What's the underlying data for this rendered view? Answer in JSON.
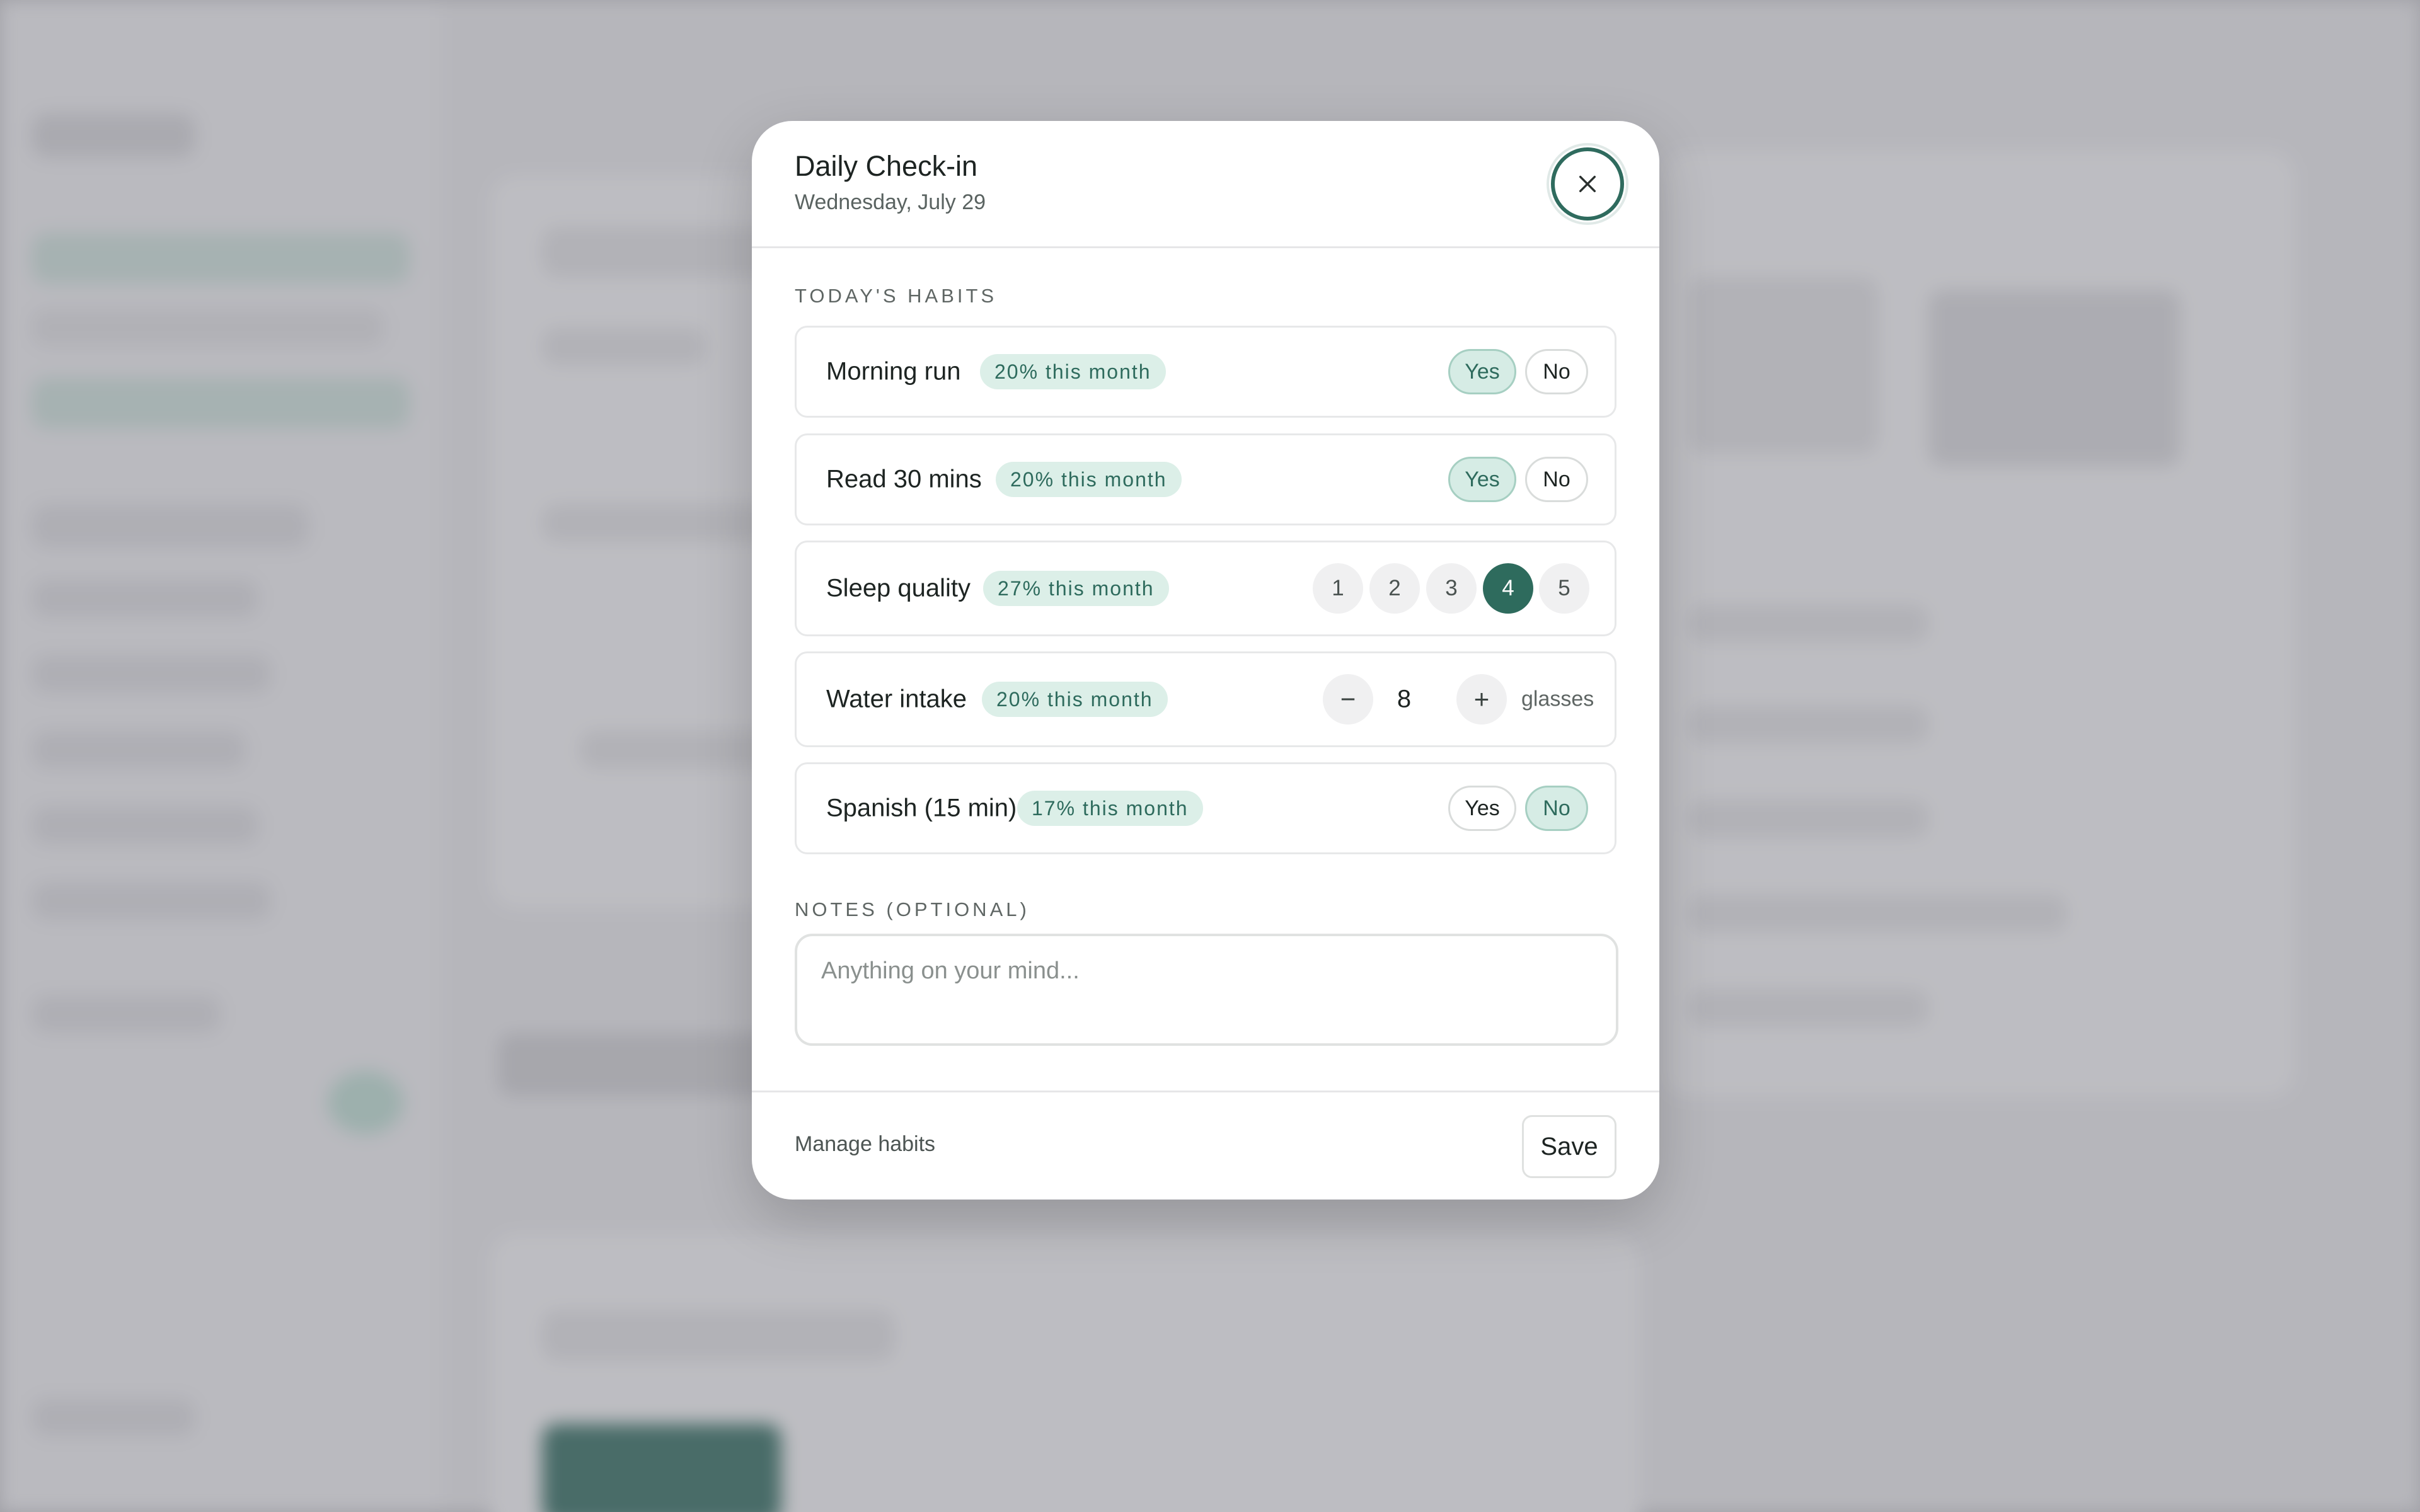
{
  "modal": {
    "title": "Daily Check-in",
    "subtitle": "Wednesday, July 29",
    "close_icon": "close-icon"
  },
  "habits_section": {
    "label": "TODAY'S HABITS",
    "habits": [
      {
        "name": "Morning run",
        "badge": "20% this month",
        "type": "yes-no",
        "yes": "Yes",
        "no": "No",
        "selected": "Yes"
      },
      {
        "name": "Read 30 mins",
        "badge": "20% this month",
        "type": "yes-no",
        "yes": "Yes",
        "no": "No",
        "selected": "Yes"
      },
      {
        "name": "Sleep quality",
        "badge": "27% this month",
        "type": "scale",
        "options": [
          "1",
          "2",
          "3",
          "4",
          "5"
        ],
        "selected": "4"
      },
      {
        "name": "Water intake",
        "badge": "20% this month",
        "type": "stepper",
        "minus": "−",
        "value": "8",
        "plus": "+",
        "unit": "glasses"
      },
      {
        "name": "Spanish (15 min)",
        "badge": "17% this month",
        "type": "yes-no",
        "yes": "Yes",
        "no": "No",
        "selected": "No"
      }
    ]
  },
  "notes": {
    "label": "NOTES (OPTIONAL)",
    "placeholder": "Anything on your mind...",
    "value": ""
  },
  "footer": {
    "manage_label": "Manage habits",
    "save_label": "Save"
  },
  "colors": {
    "accent": "#2e6b5d",
    "badge_bg": "#dcefe8",
    "selected_pill_bg": "#d6ece5"
  }
}
